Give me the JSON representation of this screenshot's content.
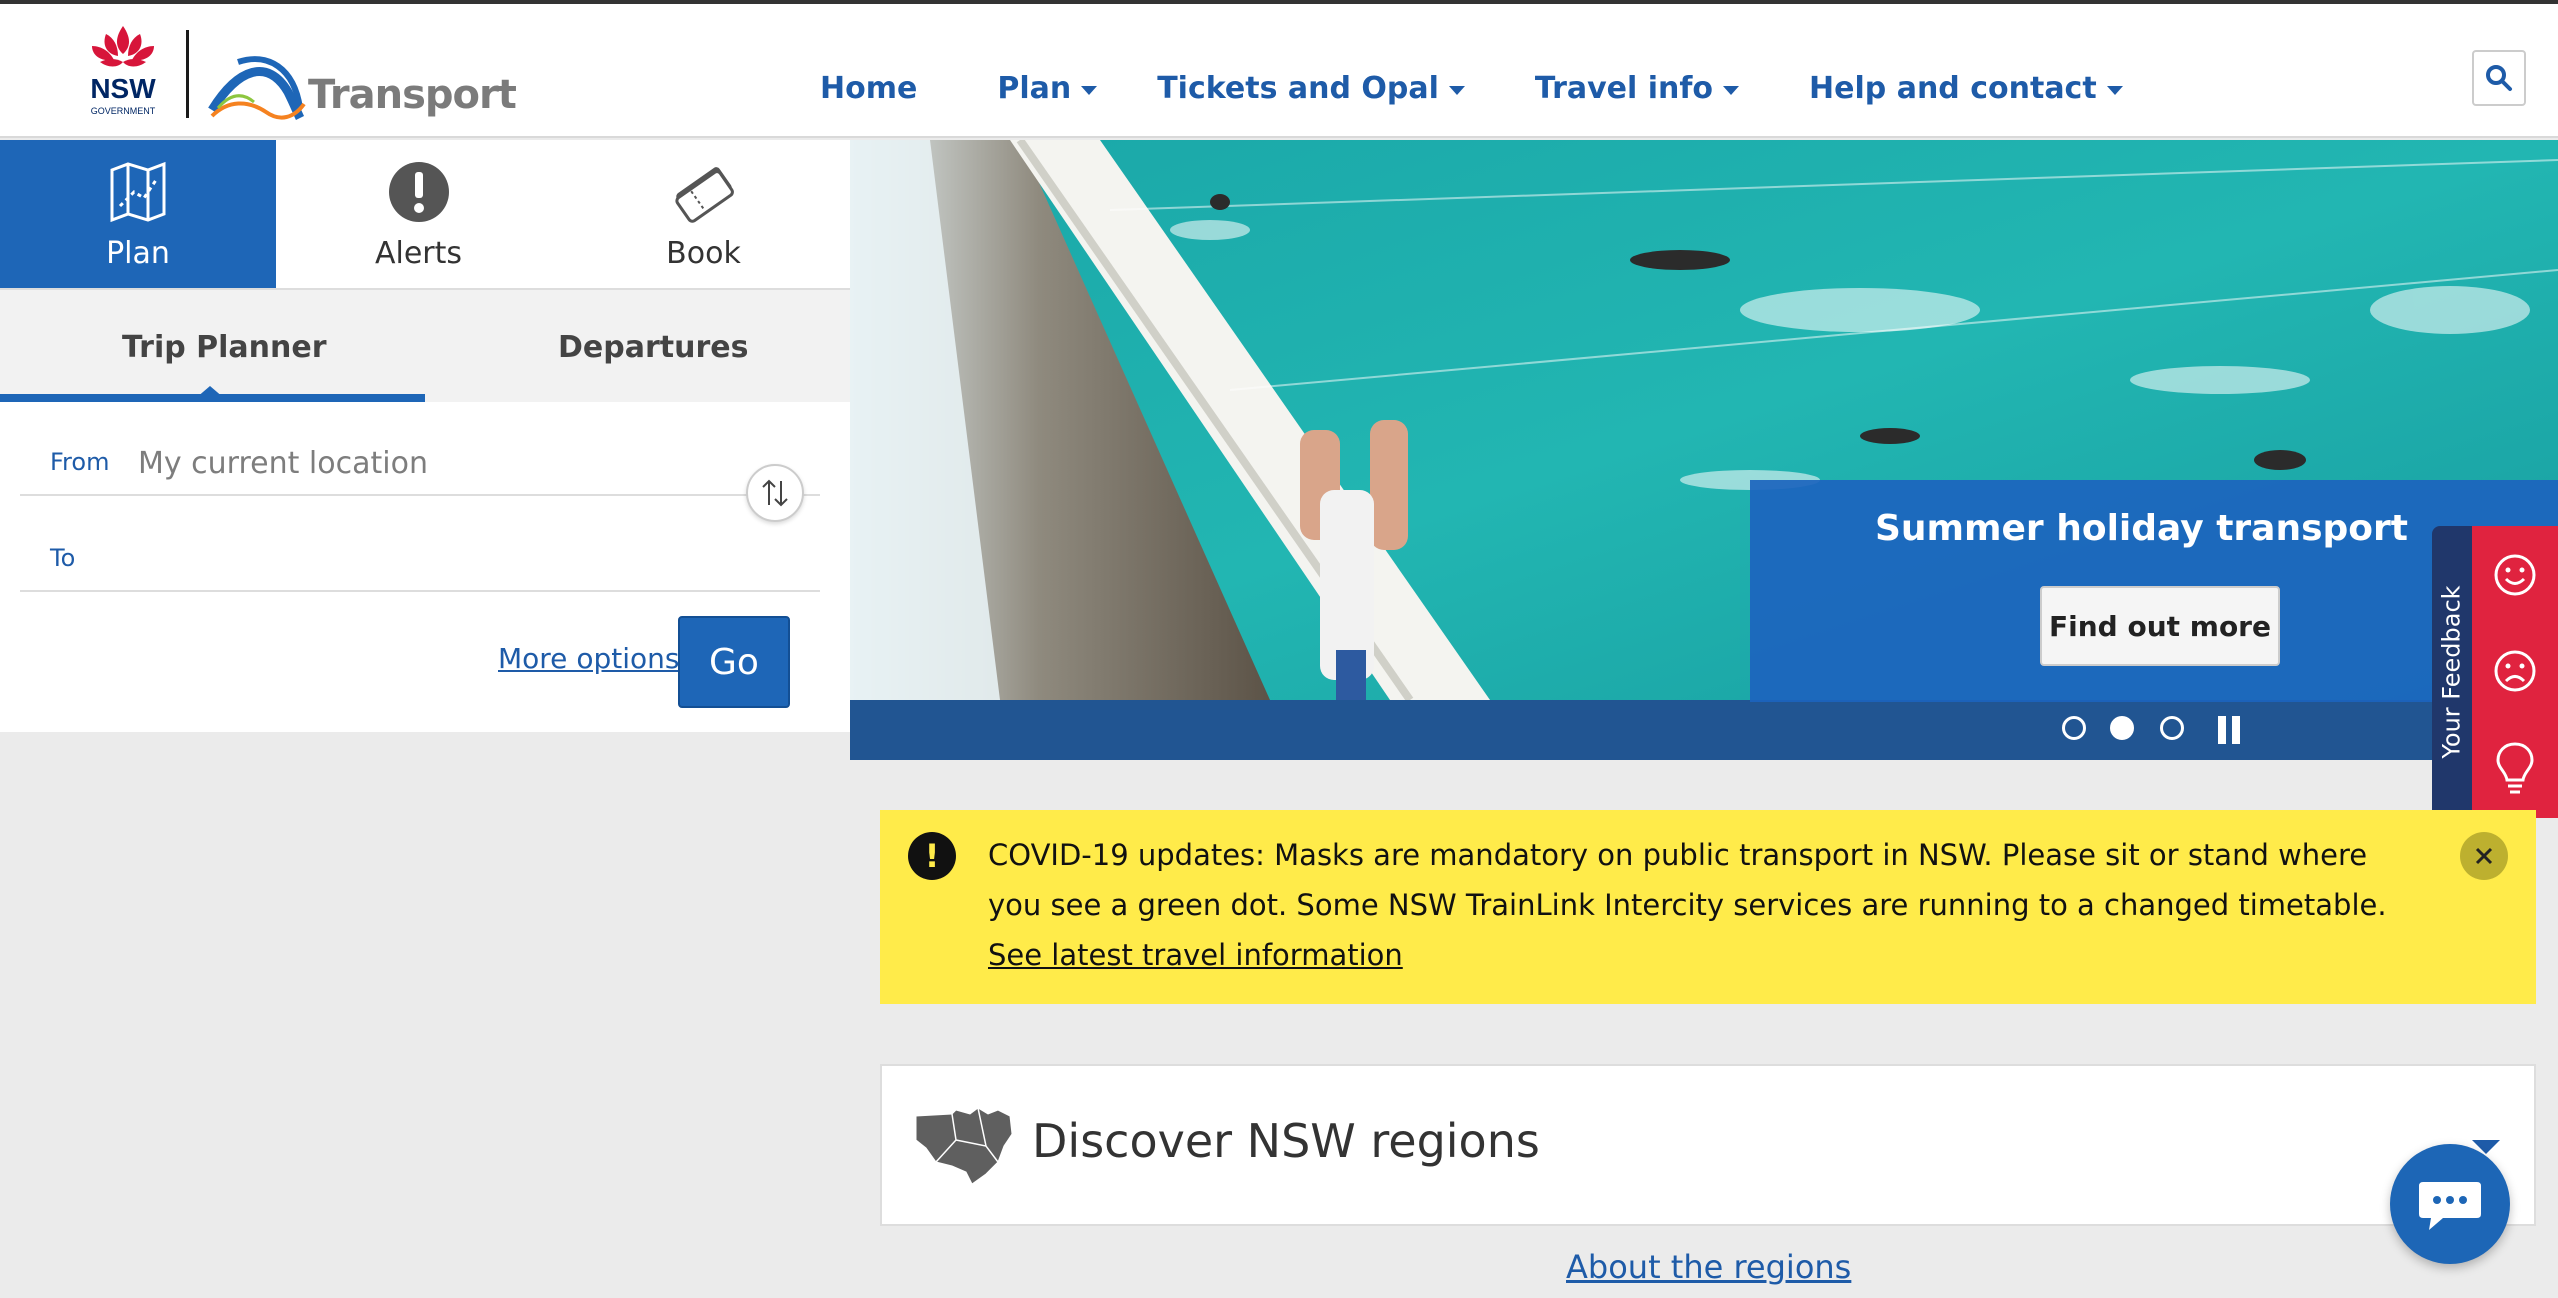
{
  "header": {
    "logo_alt": "NSW Government",
    "logo_text": "NSW",
    "logo_subtext": "GOVERNMENT",
    "brand": "Transport",
    "nav": [
      {
        "label": "Home",
        "has_menu": false
      },
      {
        "label": "Plan",
        "has_menu": true
      },
      {
        "label": "Tickets and Opal",
        "has_menu": true
      },
      {
        "label": "Travel info",
        "has_menu": true
      },
      {
        "label": "Help and contact",
        "has_menu": true
      }
    ],
    "search_icon": "search-icon"
  },
  "modes": [
    {
      "label": "Plan",
      "icon": "map-icon",
      "active": true
    },
    {
      "label": "Alerts",
      "icon": "exclamation-icon",
      "active": false
    },
    {
      "label": "Book",
      "icon": "ticket-icon",
      "active": false
    }
  ],
  "subtabs": [
    {
      "label": "Trip Planner",
      "active": true
    },
    {
      "label": "Departures",
      "active": false
    }
  ],
  "trip_form": {
    "from_label": "From",
    "from_placeholder": "My current location",
    "to_label": "To",
    "to_value": "",
    "more_options": "More options",
    "go": "Go"
  },
  "hero": {
    "promo_title": "Summer holiday transport",
    "promo_button": "Find out more",
    "slides": 3,
    "active_slide": 2
  },
  "feedback": {
    "label": "Your Feedback",
    "icons": [
      "happy-face-icon",
      "sad-face-icon",
      "lightbulb-icon"
    ]
  },
  "alert": {
    "text": "COVID-19 updates: Masks are mandatory on public transport in NSW. Please sit or stand where you see a green dot. Some NSW TrainLink Intercity services are running to a changed timetable. ",
    "link": "See latest travel information"
  },
  "discover": {
    "title": "Discover NSW regions",
    "about_link": "About the regions"
  },
  "colors": {
    "brand_blue": "#1e66b7",
    "nav_blue": "#1e5ba8",
    "alert_yellow": "#ffeb4a",
    "feedback_red": "#e0233f",
    "feedback_navy": "#20376b"
  }
}
